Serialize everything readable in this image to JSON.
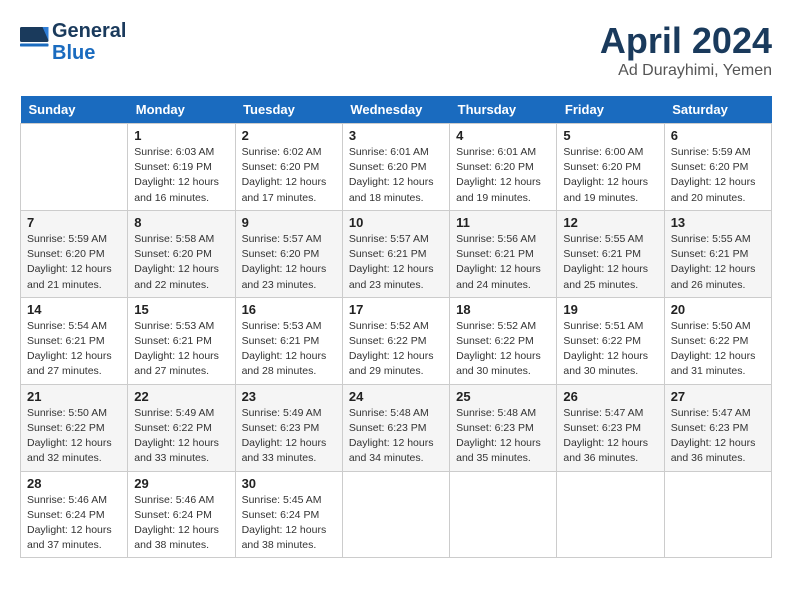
{
  "header": {
    "logo_line1": "General",
    "logo_line2": "Blue",
    "month": "April 2024",
    "location": "Ad Durayhimi, Yemen"
  },
  "days_of_week": [
    "Sunday",
    "Monday",
    "Tuesday",
    "Wednesday",
    "Thursday",
    "Friday",
    "Saturday"
  ],
  "weeks": [
    [
      {
        "day": "",
        "info": ""
      },
      {
        "day": "1",
        "info": "Sunrise: 6:03 AM\nSunset: 6:19 PM\nDaylight: 12 hours\nand 16 minutes."
      },
      {
        "day": "2",
        "info": "Sunrise: 6:02 AM\nSunset: 6:20 PM\nDaylight: 12 hours\nand 17 minutes."
      },
      {
        "day": "3",
        "info": "Sunrise: 6:01 AM\nSunset: 6:20 PM\nDaylight: 12 hours\nand 18 minutes."
      },
      {
        "day": "4",
        "info": "Sunrise: 6:01 AM\nSunset: 6:20 PM\nDaylight: 12 hours\nand 19 minutes."
      },
      {
        "day": "5",
        "info": "Sunrise: 6:00 AM\nSunset: 6:20 PM\nDaylight: 12 hours\nand 19 minutes."
      },
      {
        "day": "6",
        "info": "Sunrise: 5:59 AM\nSunset: 6:20 PM\nDaylight: 12 hours\nand 20 minutes."
      }
    ],
    [
      {
        "day": "7",
        "info": "Sunrise: 5:59 AM\nSunset: 6:20 PM\nDaylight: 12 hours\nand 21 minutes."
      },
      {
        "day": "8",
        "info": "Sunrise: 5:58 AM\nSunset: 6:20 PM\nDaylight: 12 hours\nand 22 minutes."
      },
      {
        "day": "9",
        "info": "Sunrise: 5:57 AM\nSunset: 6:20 PM\nDaylight: 12 hours\nand 23 minutes."
      },
      {
        "day": "10",
        "info": "Sunrise: 5:57 AM\nSunset: 6:21 PM\nDaylight: 12 hours\nand 23 minutes."
      },
      {
        "day": "11",
        "info": "Sunrise: 5:56 AM\nSunset: 6:21 PM\nDaylight: 12 hours\nand 24 minutes."
      },
      {
        "day": "12",
        "info": "Sunrise: 5:55 AM\nSunset: 6:21 PM\nDaylight: 12 hours\nand 25 minutes."
      },
      {
        "day": "13",
        "info": "Sunrise: 5:55 AM\nSunset: 6:21 PM\nDaylight: 12 hours\nand 26 minutes."
      }
    ],
    [
      {
        "day": "14",
        "info": "Sunrise: 5:54 AM\nSunset: 6:21 PM\nDaylight: 12 hours\nand 27 minutes."
      },
      {
        "day": "15",
        "info": "Sunrise: 5:53 AM\nSunset: 6:21 PM\nDaylight: 12 hours\nand 27 minutes."
      },
      {
        "day": "16",
        "info": "Sunrise: 5:53 AM\nSunset: 6:21 PM\nDaylight: 12 hours\nand 28 minutes."
      },
      {
        "day": "17",
        "info": "Sunrise: 5:52 AM\nSunset: 6:22 PM\nDaylight: 12 hours\nand 29 minutes."
      },
      {
        "day": "18",
        "info": "Sunrise: 5:52 AM\nSunset: 6:22 PM\nDaylight: 12 hours\nand 30 minutes."
      },
      {
        "day": "19",
        "info": "Sunrise: 5:51 AM\nSunset: 6:22 PM\nDaylight: 12 hours\nand 30 minutes."
      },
      {
        "day": "20",
        "info": "Sunrise: 5:50 AM\nSunset: 6:22 PM\nDaylight: 12 hours\nand 31 minutes."
      }
    ],
    [
      {
        "day": "21",
        "info": "Sunrise: 5:50 AM\nSunset: 6:22 PM\nDaylight: 12 hours\nand 32 minutes."
      },
      {
        "day": "22",
        "info": "Sunrise: 5:49 AM\nSunset: 6:22 PM\nDaylight: 12 hours\nand 33 minutes."
      },
      {
        "day": "23",
        "info": "Sunrise: 5:49 AM\nSunset: 6:23 PM\nDaylight: 12 hours\nand 33 minutes."
      },
      {
        "day": "24",
        "info": "Sunrise: 5:48 AM\nSunset: 6:23 PM\nDaylight: 12 hours\nand 34 minutes."
      },
      {
        "day": "25",
        "info": "Sunrise: 5:48 AM\nSunset: 6:23 PM\nDaylight: 12 hours\nand 35 minutes."
      },
      {
        "day": "26",
        "info": "Sunrise: 5:47 AM\nSunset: 6:23 PM\nDaylight: 12 hours\nand 36 minutes."
      },
      {
        "day": "27",
        "info": "Sunrise: 5:47 AM\nSunset: 6:23 PM\nDaylight: 12 hours\nand 36 minutes."
      }
    ],
    [
      {
        "day": "28",
        "info": "Sunrise: 5:46 AM\nSunset: 6:24 PM\nDaylight: 12 hours\nand 37 minutes."
      },
      {
        "day": "29",
        "info": "Sunrise: 5:46 AM\nSunset: 6:24 PM\nDaylight: 12 hours\nand 38 minutes."
      },
      {
        "day": "30",
        "info": "Sunrise: 5:45 AM\nSunset: 6:24 PM\nDaylight: 12 hours\nand 38 minutes."
      },
      {
        "day": "",
        "info": ""
      },
      {
        "day": "",
        "info": ""
      },
      {
        "day": "",
        "info": ""
      },
      {
        "day": "",
        "info": ""
      }
    ]
  ]
}
